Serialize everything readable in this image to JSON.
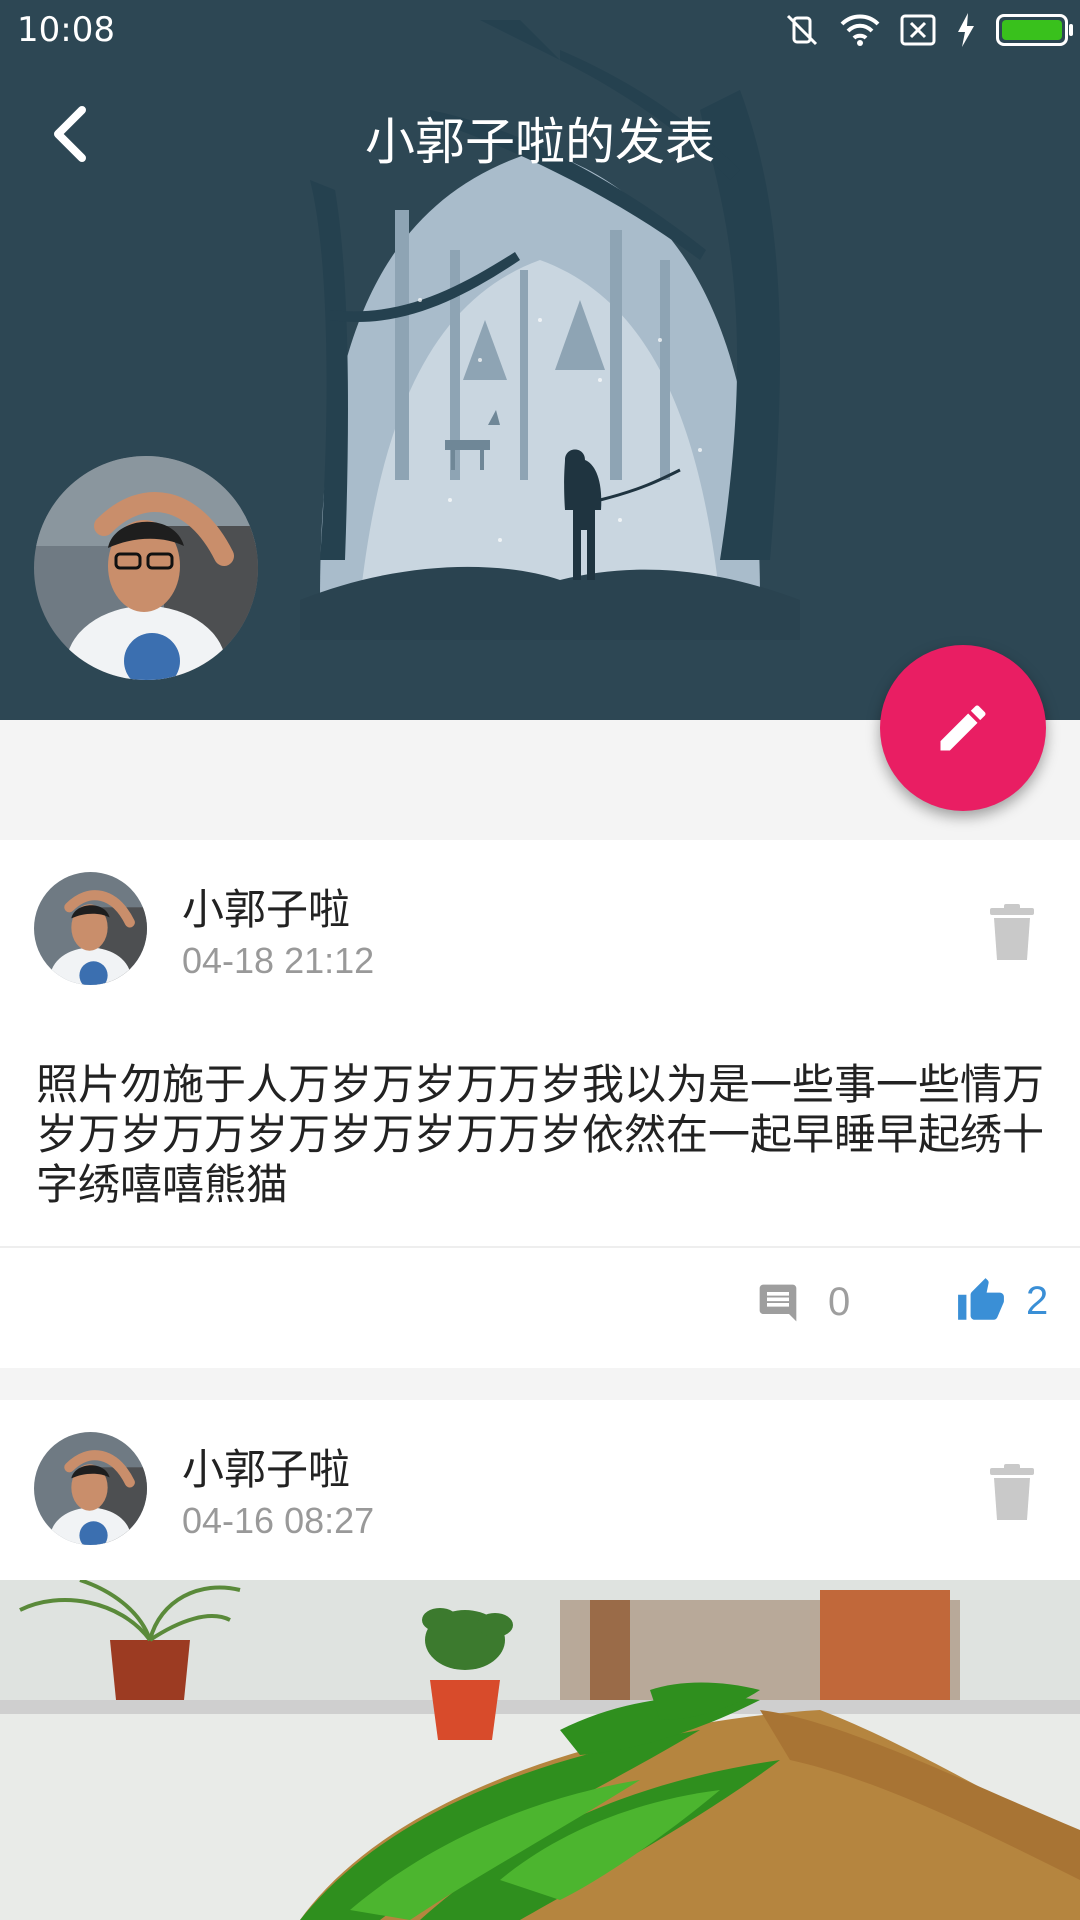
{
  "status_bar": {
    "time": "10:08",
    "icons": [
      "vibrate-off-icon",
      "wifi-icon",
      "no-sim-icon",
      "charging-icon",
      "battery-icon"
    ],
    "battery_color": "#39c11c"
  },
  "header": {
    "title": "小郭子啦的发表",
    "background_color": "#2d4754",
    "back_icon": "chevron-left-icon"
  },
  "fab": {
    "icon": "pencil-icon",
    "color": "#e91e63"
  },
  "posts": [
    {
      "author": "小郭子啦",
      "time": "04-18 21:12",
      "text": "照片勿施于人万岁万岁万万岁我以为是一些事一些情万岁万岁万万岁万岁万岁万万岁依然在一起早睡早起绣十字绣嘻嘻熊猫",
      "comments": "0",
      "likes": "2",
      "like_color": "#3a8fd6"
    },
    {
      "author": "小郭子啦",
      "time": "04-16 08:27"
    }
  ]
}
